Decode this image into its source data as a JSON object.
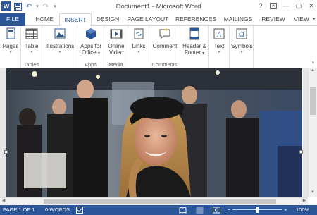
{
  "window": {
    "title": "Document1 - Microsoft Word",
    "help": "?",
    "minimize": "—",
    "restore": "▢",
    "close": "✕"
  },
  "qat": {
    "app": "W",
    "save": "💾",
    "undo": "↶",
    "redo": "↷",
    "more": "▾"
  },
  "tabs": {
    "file": "FILE",
    "home": "HOME",
    "insert": "INSERT",
    "design": "DESIGN",
    "page_layout": "PAGE LAYOUT",
    "references": "REFERENCES",
    "mailings": "MAILINGS",
    "review": "REVIEW",
    "view": "VIEW"
  },
  "ribbon": {
    "pages": {
      "label": "Pages"
    },
    "tables": {
      "table": "Table",
      "group": "Tables"
    },
    "illustrations": {
      "label": "Illustrations"
    },
    "apps": {
      "label1": "Apps for",
      "label2": "Office",
      "group": "Apps"
    },
    "media": {
      "label1": "Online",
      "label2": "Video",
      "group": "Media"
    },
    "links": {
      "label": "Links"
    },
    "comments": {
      "comment": "Comment",
      "group": "Comments"
    },
    "header_footer": {
      "label1": "Header &",
      "label2": "Footer"
    },
    "text": {
      "label": "Text"
    },
    "symbols": {
      "label": "Symbols"
    }
  },
  "status": {
    "page": "PAGE 1 OF 1",
    "words": "0 WORDS",
    "zoom_minus": "−",
    "zoom_plus": "+",
    "zoom": "100%",
    "zoom_level": 1.0
  },
  "colors": {
    "accent": "#2b579a"
  },
  "image": {
    "description": "photo of smiling woman wearing black cap at a trade show"
  }
}
